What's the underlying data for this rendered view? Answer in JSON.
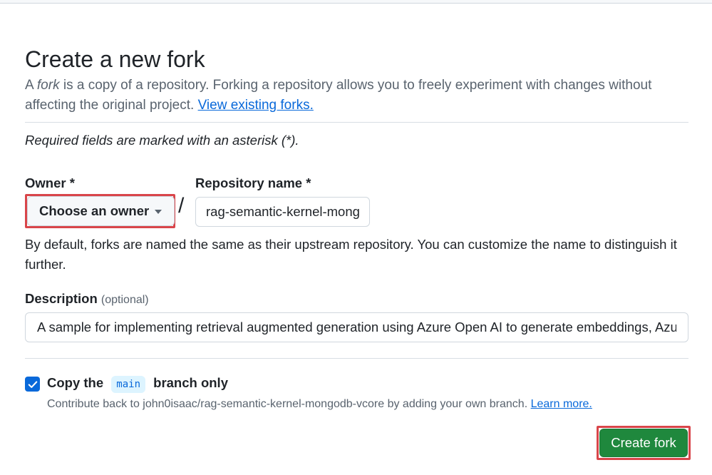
{
  "page": {
    "title": "Create a new fork",
    "lead_prefix": "A",
    "lead_fork_word": "fork",
    "lead_text": "is a copy of a repository. Forking a repository allows you to freely experiment with changes without affecting the original project.",
    "view_forks_link": "View existing forks.",
    "required_note": "Required fields are marked with an asterisk (*)."
  },
  "owner": {
    "label": "Owner *",
    "button_label": "Choose an owner"
  },
  "repo_name": {
    "label": "Repository name *",
    "value": "rag-semantic-kernel-mongodb-vcore",
    "separator": "/",
    "help_text": "By default, forks are named the same as their upstream repository. You can customize the name to distinguish it further."
  },
  "description": {
    "label": "Description",
    "optional_label": "(optional)",
    "value": "A sample for implementing retrieval augmented generation using Azure Open AI to generate embeddings, Azure Cosmos DB for MongoDB vCore"
  },
  "copy_branch": {
    "checked": true,
    "label_before": "Copy the",
    "branch_chip": "main",
    "label_after": "branch only",
    "note": "Contribute back to john0isaac/rag-semantic-kernel-mongodb-vcore by adding your own branch.",
    "learn_more_link": "Learn more."
  },
  "actions": {
    "create_fork_label": "Create fork"
  },
  "colors": {
    "primary_button": "#1f883d",
    "link": "#0969da",
    "highlight_border": "#d9454a",
    "checkbox": "#0969da"
  },
  "icons": {
    "dropdown": "caret-down-icon",
    "checkbox": "checkmark-icon"
  }
}
